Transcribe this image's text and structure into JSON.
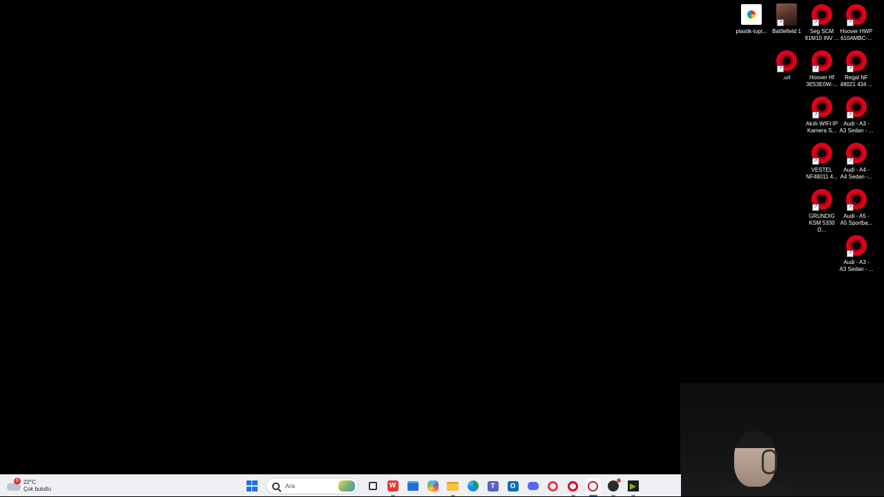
{
  "desktop": {
    "icons": [
      {
        "label": "plastik-topl...",
        "icon": "image-file-icon"
      },
      {
        "label": "Battlefield 1",
        "icon": "battlefield-1-icon"
      },
      {
        "label": "Seg SCM\n91M10 INV ...",
        "icon": "opera-shortcut-icon"
      },
      {
        "label": "Hoover HWP\n610AMBC-...",
        "icon": "opera-shortcut-icon"
      },
      {
        "label": ".url",
        "icon": "opera-shortcut-icon"
      },
      {
        "label": "Hoover Hf\n3E53E0W-...",
        "icon": "opera-shortcut-icon"
      },
      {
        "label": "Regal NF\n48021 434 ...",
        "icon": "opera-shortcut-icon"
      },
      {
        "label": "Akıllı WIFI IP\nKamera S...",
        "icon": "opera-shortcut-icon"
      },
      {
        "label": "Audi - A3 -\nA3 Sedan - ...",
        "icon": "opera-shortcut-icon"
      },
      {
        "label": "VESTEL\nNF48011 4...",
        "icon": "opera-shortcut-icon"
      },
      {
        "label": "Audi - A4 -\nA4 Sedan -...",
        "icon": "opera-shortcut-icon"
      },
      {
        "label": "GRUNDIG\nKSM 5330 D...",
        "icon": "opera-shortcut-icon"
      },
      {
        "label": "Audi - A5 -\nA5 Sportba...",
        "icon": "opera-shortcut-icon"
      },
      {
        "label": "Audi - A3 -\nA3 Sedan - ...",
        "icon": "opera-shortcut-icon"
      }
    ]
  },
  "taskbar": {
    "weather": {
      "badge": "6",
      "temperature": "22°C",
      "condition": "Çok bulutlu"
    },
    "search": {
      "placeholder": "Ara"
    },
    "apps": [
      "start",
      "search",
      "task-view",
      "wps-office",
      "microsoft-store",
      "copilot",
      "file-explorer",
      "edge",
      "teams",
      "outlook",
      "discord",
      "opera-gx",
      "opera",
      "opera-browser",
      "obs",
      "nvidia"
    ]
  },
  "colors": {
    "desktop_bg": "#000000",
    "taskbar_bg": "#eef0f4",
    "opera_red": "#e0001b",
    "accent": "#1a73e8"
  }
}
